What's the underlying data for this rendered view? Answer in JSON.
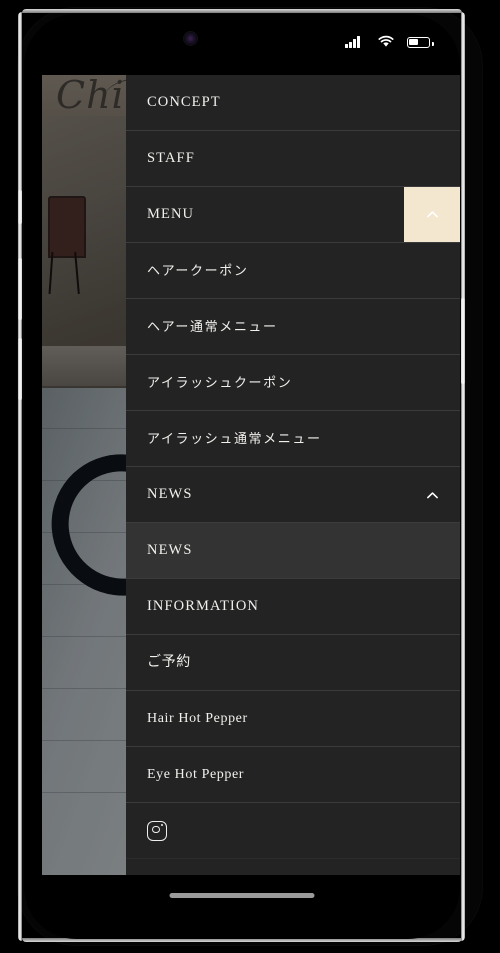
{
  "device": {
    "status_bar": {
      "signal_icon": "cellular-signal-icon",
      "wifi_icon": "wifi-icon",
      "battery_icon": "battery-icon",
      "camera_icon": "front-camera-icon"
    },
    "home_indicator": "home-indicator-bar",
    "buttons": [
      "mute-switch",
      "volume-up",
      "volume-down",
      "power-button"
    ]
  },
  "background": {
    "logo_text": "Chi",
    "photos": [
      "salon-interior-photo",
      "wooden-wall-logo-photo"
    ]
  },
  "colors": {
    "drawer_bg": "#232323",
    "drawer_bg_active": "#333333",
    "divider": "#3b3b3b",
    "accent": "#f4e7cf",
    "text": "#f2f0ec"
  },
  "drawer": {
    "items": [
      {
        "label": "CONCEPT",
        "type": "top",
        "toggle": false,
        "style": "en"
      },
      {
        "label": "STAFF",
        "type": "top",
        "toggle": false,
        "style": "en"
      },
      {
        "label": "MENU",
        "type": "top",
        "toggle": true,
        "toggle_style": "accent",
        "toggle_icon": "chevron-up-icon",
        "style": "en"
      },
      {
        "label": "ヘアークーポン",
        "type": "sub",
        "toggle": false,
        "style": "jp"
      },
      {
        "label": "ヘアー通常メニュー",
        "type": "sub",
        "toggle": false,
        "style": "jp"
      },
      {
        "label": "アイラッシュクーポン",
        "type": "sub",
        "toggle": false,
        "style": "jp"
      },
      {
        "label": "アイラッシュ通常メニュー",
        "type": "sub",
        "toggle": false,
        "style": "jp"
      },
      {
        "label": "NEWS",
        "type": "top",
        "toggle": true,
        "toggle_style": "plain",
        "toggle_icon": "chevron-up-icon",
        "style": "en"
      },
      {
        "label": "NEWS",
        "type": "sub",
        "toggle": false,
        "style": "en",
        "active": true
      },
      {
        "label": "INFORMATION",
        "type": "top",
        "toggle": false,
        "style": "en"
      },
      {
        "label": "ご予約",
        "type": "sub",
        "toggle": false,
        "style": "jp-sml"
      },
      {
        "label": "Hair Hot Pepper",
        "type": "sub",
        "toggle": false,
        "style": "sml"
      },
      {
        "label": "Eye Hot Pepper",
        "type": "sub",
        "toggle": false,
        "style": "sml"
      }
    ],
    "social": {
      "instagram_icon": "instagram-icon"
    }
  }
}
